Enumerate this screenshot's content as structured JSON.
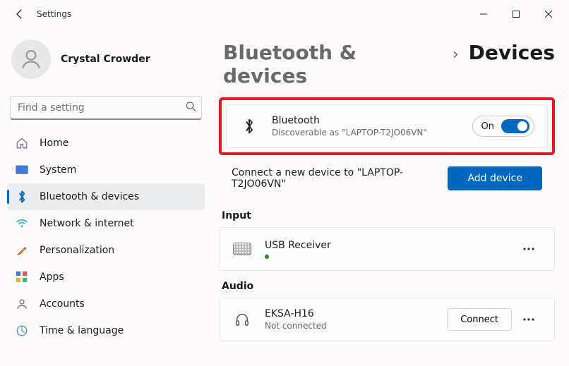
{
  "app": {
    "title": "Settings"
  },
  "profile": {
    "name": "Crystal Crowder"
  },
  "search": {
    "placeholder": "Find a setting"
  },
  "nav": {
    "items": [
      {
        "label": "Home"
      },
      {
        "label": "System"
      },
      {
        "label": "Bluetooth & devices"
      },
      {
        "label": "Network & internet"
      },
      {
        "label": "Personalization"
      },
      {
        "label": "Apps"
      },
      {
        "label": "Accounts"
      },
      {
        "label": "Time & language"
      }
    ]
  },
  "breadcrumb": {
    "parent": "Bluetooth & devices",
    "current": "Devices"
  },
  "bluetooth_card": {
    "title": "Bluetooth",
    "subtitle": "Discoverable as \"LAPTOP-T2JO06VN\"",
    "toggle_label": "On"
  },
  "connect_row": {
    "text": "Connect a new device to \"LAPTOP-T2JO06VN\"",
    "button": "Add device"
  },
  "sections": {
    "input": {
      "label": "Input",
      "device": {
        "name": "USB Receiver"
      }
    },
    "audio": {
      "label": "Audio",
      "device": {
        "name": "EKSA-H16",
        "status": "Not connected",
        "action": "Connect"
      }
    }
  }
}
